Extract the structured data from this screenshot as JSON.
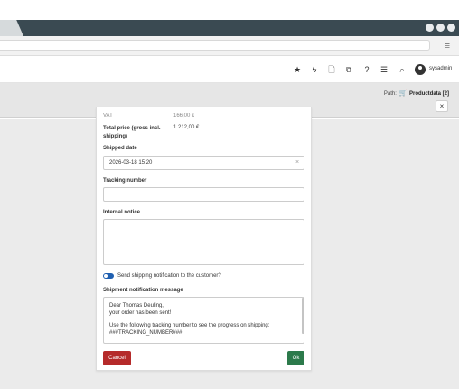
{
  "toolbar": {
    "icons": [
      "star-icon",
      "bolt-icon",
      "document-icon",
      "copy-icon",
      "help-icon",
      "list-icon",
      "search-icon"
    ],
    "username": "sysadmin"
  },
  "path": {
    "label": "Path:",
    "item": "Productdata [2]",
    "close": "×"
  },
  "order": {
    "cut_label": "VAT",
    "cut_value": "166,00 €",
    "total_label": "Total price (gross incl. shipping)",
    "total_value": "1.212,00 €"
  },
  "form": {
    "shipped_date_label": "Shipped date",
    "shipped_date_value": "2026-03-18 15:20",
    "clear": "×",
    "tracking_label": "Tracking number",
    "tracking_value": "",
    "notice_label": "Internal notice",
    "notice_value": "",
    "notify_toggle_label": "Send shipping notification to the customer?",
    "notify_enabled": true,
    "message_label": "Shipment notification message",
    "message_lines": [
      "Dear Thomas Deuling,",
      "your order has been sent!",
      "",
      "Use the following tracking number to see the progress on shipping:",
      "###TRACKING_NUMBER###"
    ]
  },
  "buttons": {
    "cancel": "Cancel",
    "ok": "Ok"
  },
  "colors": {
    "cancel": "#b52a2a",
    "ok": "#2c7a4b",
    "toggle": "#1f5fb0",
    "titlebar": "#3a4a52"
  }
}
